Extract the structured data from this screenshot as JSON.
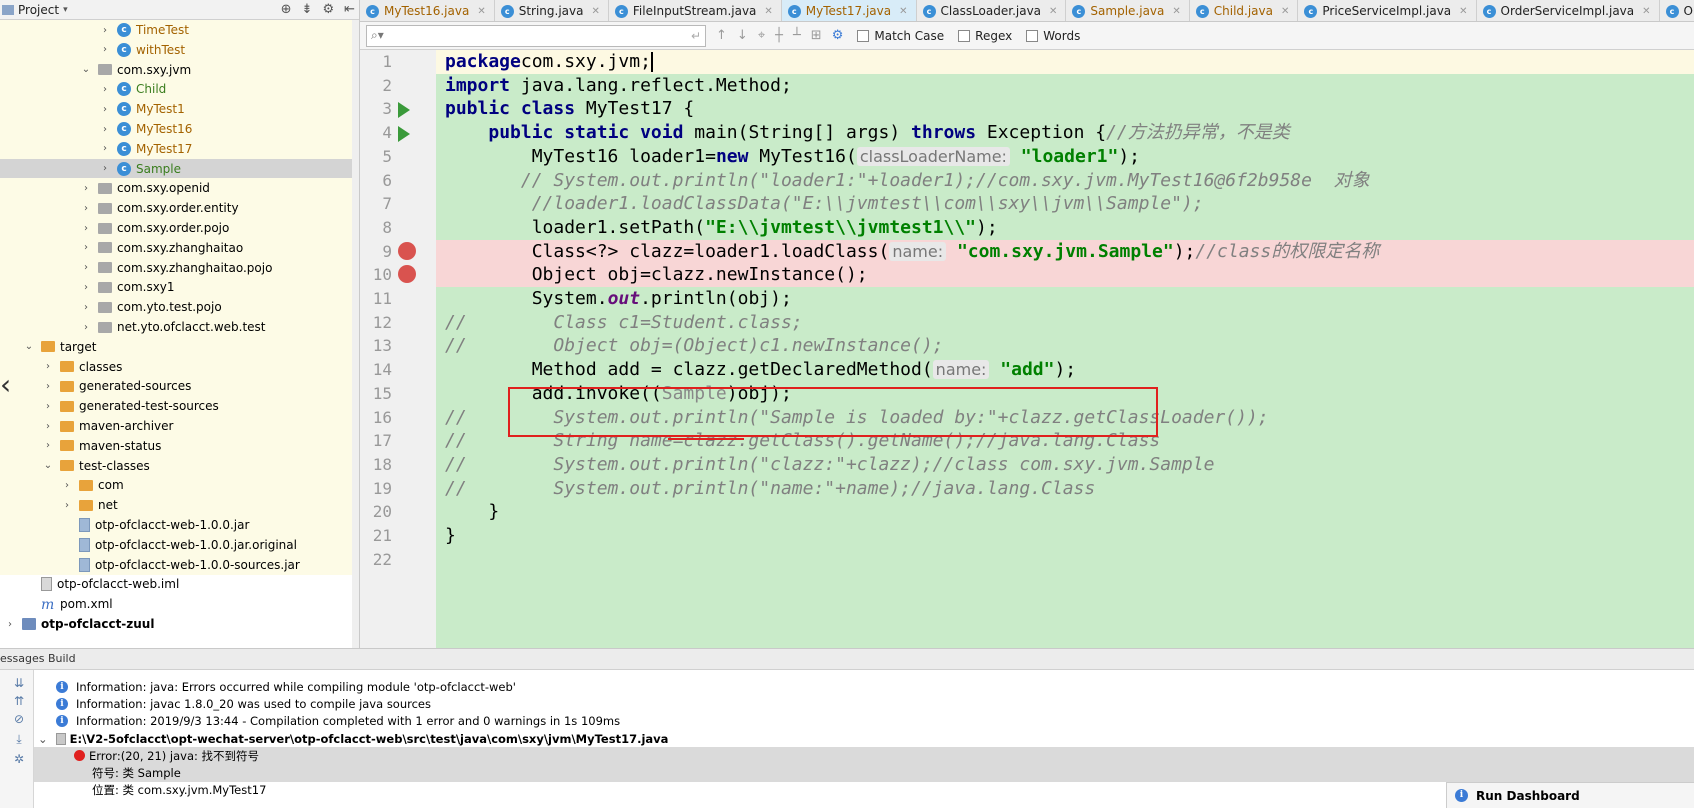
{
  "project_panel": {
    "title": "Project",
    "tree": [
      {
        "label": "TimeTest",
        "kind": "class",
        "indent": 5,
        "arrow": "›",
        "style": "orange",
        "bg": "yellow"
      },
      {
        "label": "withTest",
        "kind": "class",
        "indent": 5,
        "arrow": "›",
        "style": "orange",
        "bg": "yellow"
      },
      {
        "label": "com.sxy.jvm",
        "kind": "pkg",
        "indent": 4,
        "arrow": "⌄",
        "style": "",
        "bg": "yellow"
      },
      {
        "label": "Child",
        "kind": "class",
        "indent": 5,
        "arrow": "›",
        "style": "green",
        "bg": "yellow"
      },
      {
        "label": "MyTest1",
        "kind": "class",
        "indent": 5,
        "arrow": "›",
        "style": "orange",
        "bg": "yellow"
      },
      {
        "label": "MyTest16",
        "kind": "class",
        "indent": 5,
        "arrow": "›",
        "style": "orange",
        "bg": "yellow"
      },
      {
        "label": "MyTest17",
        "kind": "class",
        "indent": 5,
        "arrow": "›",
        "style": "orange",
        "bg": "yellow"
      },
      {
        "label": "Sample",
        "kind": "class",
        "indent": 5,
        "arrow": "›",
        "style": "green",
        "bg": "selected"
      },
      {
        "label": "com.sxy.openid",
        "kind": "pkg",
        "indent": 4,
        "arrow": "›",
        "style": "",
        "bg": "yellow"
      },
      {
        "label": "com.sxy.order.entity",
        "kind": "pkg",
        "indent": 4,
        "arrow": "›",
        "style": "",
        "bg": "yellow"
      },
      {
        "label": "com.sxy.order.pojo",
        "kind": "pkg",
        "indent": 4,
        "arrow": "›",
        "style": "",
        "bg": "yellow"
      },
      {
        "label": "com.sxy.zhanghaitao",
        "kind": "pkg",
        "indent": 4,
        "arrow": "›",
        "style": "",
        "bg": "yellow"
      },
      {
        "label": "com.sxy.zhanghaitao.pojo",
        "kind": "pkg",
        "indent": 4,
        "arrow": "›",
        "style": "",
        "bg": "yellow"
      },
      {
        "label": "com.sxy1",
        "kind": "pkg",
        "indent": 4,
        "arrow": "›",
        "style": "",
        "bg": "yellow"
      },
      {
        "label": "com.yto.test.pojo",
        "kind": "pkg",
        "indent": 4,
        "arrow": "›",
        "style": "",
        "bg": "yellow"
      },
      {
        "label": "net.yto.ofclacct.web.test",
        "kind": "pkg",
        "indent": 4,
        "arrow": "›",
        "style": "",
        "bg": "yellow"
      },
      {
        "label": "target",
        "kind": "folder",
        "indent": 1,
        "arrow": "⌄",
        "style": "",
        "bg": "yellow"
      },
      {
        "label": "classes",
        "kind": "folder",
        "indent": 2,
        "arrow": "›",
        "style": "",
        "bg": "yellow"
      },
      {
        "label": "generated-sources",
        "kind": "folder",
        "indent": 2,
        "arrow": "›",
        "style": "",
        "bg": "yellow"
      },
      {
        "label": "generated-test-sources",
        "kind": "folder",
        "indent": 2,
        "arrow": "›",
        "style": "",
        "bg": "yellow"
      },
      {
        "label": "maven-archiver",
        "kind": "folder",
        "indent": 2,
        "arrow": "›",
        "style": "",
        "bg": "yellow"
      },
      {
        "label": "maven-status",
        "kind": "folder",
        "indent": 2,
        "arrow": "›",
        "style": "",
        "bg": "yellow"
      },
      {
        "label": "test-classes",
        "kind": "folder",
        "indent": 2,
        "arrow": "⌄",
        "style": "",
        "bg": "yellow"
      },
      {
        "label": "com",
        "kind": "folder",
        "indent": 3,
        "arrow": "›",
        "style": "",
        "bg": "yellow"
      },
      {
        "label": "net",
        "kind": "folder",
        "indent": 3,
        "arrow": "›",
        "style": "",
        "bg": "yellow"
      },
      {
        "label": "otp-ofclacct-web-1.0.0.jar",
        "kind": "jar",
        "indent": 3,
        "arrow": "",
        "style": "",
        "bg": "yellow"
      },
      {
        "label": "otp-ofclacct-web-1.0.0.jar.original",
        "kind": "jar",
        "indent": 3,
        "arrow": "",
        "style": "",
        "bg": "yellow"
      },
      {
        "label": "otp-ofclacct-web-1.0.0-sources.jar",
        "kind": "jar",
        "indent": 3,
        "arrow": "",
        "style": "",
        "bg": "yellow"
      },
      {
        "label": "otp-ofclacct-web.iml",
        "kind": "iml",
        "indent": 1,
        "arrow": "",
        "style": "",
        "bg": "none"
      },
      {
        "label": "pom.xml",
        "kind": "m",
        "indent": 1,
        "arrow": "",
        "style": "",
        "bg": "none"
      },
      {
        "label": "otp-ofclacct-zuul",
        "kind": "module",
        "indent": 0,
        "arrow": "›",
        "style": "bold",
        "bg": "none"
      }
    ]
  },
  "editor_tabs": [
    {
      "name": "MyTest16.java",
      "style": "orange",
      "active": false
    },
    {
      "name": "String.java",
      "style": "",
      "active": false
    },
    {
      "name": "FileInputStream.java",
      "style": "",
      "active": false
    },
    {
      "name": "MyTest17.java",
      "style": "orange",
      "active": true
    },
    {
      "name": "ClassLoader.java",
      "style": "",
      "active": false
    },
    {
      "name": "Sample.java",
      "style": "orange",
      "active": false
    },
    {
      "name": "Child.java",
      "style": "orange",
      "active": false
    },
    {
      "name": "PriceServiceImpl.java",
      "style": "",
      "active": false
    },
    {
      "name": "OrderServiceImpl.java",
      "style": "",
      "active": false
    },
    {
      "name": "OrderStatus.java",
      "style": "",
      "active": false
    }
  ],
  "find_bar": {
    "search_value": "",
    "match_case": "Match Case",
    "regex": "Regex",
    "words": "Words"
  },
  "code": {
    "lines": [
      {
        "n": "1",
        "bg": "yellow",
        "gicon": "",
        "segs": [
          [
            "kw",
            "package"
          ],
          [
            "",
            "com.sxy.jvm;"
          ]
        ]
      },
      {
        "n": "2",
        "bg": "",
        "gicon": "",
        "segs": [
          [
            "kw",
            "import"
          ],
          [
            "",
            " java.lang.reflect.Method;"
          ]
        ]
      },
      {
        "n": "3",
        "bg": "",
        "gicon": "run",
        "segs": [
          [
            "kw",
            "public class"
          ],
          [
            "",
            " MyTest17 {"
          ]
        ]
      },
      {
        "n": "4",
        "bg": "",
        "gicon": "run",
        "segs": [
          [
            "",
            "    "
          ],
          [
            "kw",
            "public static void"
          ],
          [
            "",
            " main(String[] args) "
          ],
          [
            "kw",
            "throws"
          ],
          [
            "",
            " Exception {"
          ],
          [
            "cmt",
            "//方法扔异常，不是类"
          ]
        ]
      },
      {
        "n": "5",
        "bg": "",
        "gicon": "",
        "segs": [
          [
            "",
            "        MyTest16 loader1="
          ],
          [
            "kw",
            "new"
          ],
          [
            "",
            " MyTest16("
          ],
          [
            "hint",
            "classLoaderName:"
          ],
          [
            "",
            " "
          ],
          [
            "str",
            "\"loader1\""
          ],
          [
            "",
            ");"
          ]
        ]
      },
      {
        "n": "6",
        "bg": "",
        "gicon": "",
        "segs": [
          [
            "",
            "       "
          ],
          [
            "cmt",
            "// System.out.println(\"loader1:\"+loader1);//com.sxy.jvm.MyTest16@6f2b958e  对象"
          ]
        ]
      },
      {
        "n": "7",
        "bg": "",
        "gicon": "",
        "segs": [
          [
            "",
            "        "
          ],
          [
            "cmt",
            "//loader1.loadClassData(\"E:\\\\jvmtest\\\\com\\\\sxy\\\\jvm\\\\Sample\");"
          ]
        ]
      },
      {
        "n": "8",
        "bg": "",
        "gicon": "",
        "segs": [
          [
            "",
            "        loader1.setPath("
          ],
          [
            "str",
            "\"E:\\\\jvmtest\\\\jvmtest1\\\\\""
          ],
          [
            "",
            ");"
          ]
        ]
      },
      {
        "n": "9",
        "bg": "red",
        "gicon": "bp",
        "segs": [
          [
            "",
            "        Class<?> clazz=loader1.loadClass("
          ],
          [
            "hint",
            "name:"
          ],
          [
            "",
            " "
          ],
          [
            "str",
            "\"com.sxy.jvm.Sample\""
          ],
          [
            "",
            ");"
          ],
          [
            "cmt",
            "//class的权限定名称"
          ]
        ]
      },
      {
        "n": "10",
        "bg": "red",
        "gicon": "bp",
        "segs": [
          [
            "",
            "        Object obj=clazz.newInstance();"
          ]
        ]
      },
      {
        "n": "11",
        "bg": "",
        "gicon": "",
        "segs": [
          [
            "",
            "        System."
          ],
          [
            "fld",
            "out"
          ],
          [
            "",
            ".println(obj);"
          ]
        ]
      },
      {
        "n": "12",
        "bg": "",
        "gicon": "",
        "segs": [
          [
            "cmt",
            "//        Class c1=Student.class;"
          ]
        ]
      },
      {
        "n": "13",
        "bg": "",
        "gicon": "",
        "segs": [
          [
            "cmt",
            "//        Object obj=(Object)c1.newInstance();"
          ]
        ]
      },
      {
        "n": "14",
        "bg": "",
        "gicon": "",
        "segs": [
          [
            "",
            "        Method add = clazz.getDeclaredMethod("
          ],
          [
            "hint",
            "name:"
          ],
          [
            "",
            " "
          ],
          [
            "str",
            "\"add\""
          ],
          [
            "",
            ");"
          ]
        ]
      },
      {
        "n": "15",
        "bg": "",
        "gicon": "",
        "segs": [
          [
            "",
            "        add.invoke(("
          ],
          [
            "grey",
            "Sample"
          ],
          [
            "",
            ")obj);"
          ]
        ]
      },
      {
        "n": "16",
        "bg": "",
        "gicon": "",
        "segs": [
          [
            "cmt",
            "//        System.out.println(\"Sample is loaded by:\"+clazz.getClassLoader());"
          ]
        ]
      },
      {
        "n": "17",
        "bg": "",
        "gicon": "",
        "segs": [
          [
            "cmt",
            "//        String name=clazz.getClass().getName();//java.lang.Class"
          ]
        ]
      },
      {
        "n": "18",
        "bg": "",
        "gicon": "",
        "segs": [
          [
            "cmt",
            "//        System.out.println(\"clazz:\"+clazz);//class com.sxy.jvm.Sample"
          ]
        ]
      },
      {
        "n": "19",
        "bg": "",
        "gicon": "",
        "segs": [
          [
            "cmt",
            "//        System.out.println(\"name:\"+name);//java.lang.Class"
          ]
        ]
      },
      {
        "n": "20",
        "bg": "",
        "gicon": "",
        "segs": [
          [
            "",
            "    }"
          ]
        ]
      },
      {
        "n": "21",
        "bg": "",
        "gicon": "",
        "segs": [
          [
            "",
            "}"
          ]
        ]
      },
      {
        "n": "22",
        "bg": "",
        "gicon": "",
        "segs": [
          [
            "",
            ""
          ]
        ]
      }
    ]
  },
  "messages": {
    "header": "essages Build",
    "rows": [
      {
        "type": "info",
        "text": "Information: java: Errors occurred while compiling module 'otp-ofclacct-web'",
        "indent": 1,
        "grey": false
      },
      {
        "type": "info",
        "text": "Information: javac 1.8.0_20 was used to compile java sources",
        "indent": 1,
        "grey": false
      },
      {
        "type": "info",
        "text": "Information: 2019/9/3 13:44 - Compilation completed with 1 error and 0 warnings in 1s 109ms",
        "indent": 1,
        "grey": false
      },
      {
        "type": "path",
        "text": "E:\\V2-5ofclacct\\opt-wechat-server\\otp-ofclacct-web\\src\\test\\java\\com\\sxy\\jvm\\MyTest17.java",
        "indent": 0,
        "grey": false
      },
      {
        "type": "error",
        "text": "Error:(20, 21)  java: 找不到符号",
        "indent": 2,
        "grey": true
      },
      {
        "type": "plain",
        "text": "符号:   类 Sample",
        "indent": 3,
        "grey": true
      },
      {
        "type": "plain",
        "text": "位置: 类 com.sxy.jvm.MyTest17",
        "indent": 3,
        "grey": false
      }
    ]
  },
  "run_dashboard": "Run Dashboard",
  "colors": {
    "accent_red": "#e0201e",
    "code_green_bg": "#c9ebc9"
  }
}
